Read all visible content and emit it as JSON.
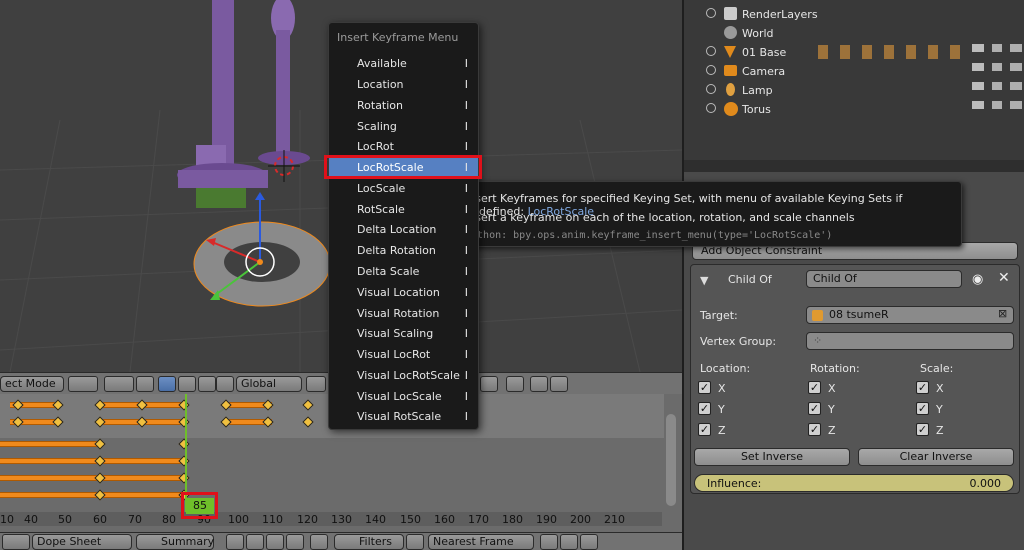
{
  "header3d": {
    "mode_label": "ect Mode",
    "orientation_label": "Global"
  },
  "dopesheet": {
    "current_frame": "85",
    "ruler_ticks": [
      "10",
      "40",
      "50",
      "60",
      "70",
      "80",
      "90",
      "100",
      "110",
      "120",
      "130",
      "140",
      "150",
      "160",
      "170",
      "180",
      "190",
      "200",
      "210"
    ]
  },
  "footer": {
    "editor_label": "Dope Sheet",
    "mode_label": "Summary",
    "filters_label": "Filters",
    "snap_label": "Nearest Frame"
  },
  "outliner": {
    "items": [
      {
        "label": "RenderLayers"
      },
      {
        "label": "World"
      },
      {
        "label": "01 Base"
      },
      {
        "label": "Camera"
      },
      {
        "label": "Lamp"
      },
      {
        "label": "Torus"
      }
    ]
  },
  "menu": {
    "title": "Insert Keyframe Menu",
    "items": [
      {
        "label": "Available",
        "shortcut": "I"
      },
      {
        "label": "Location",
        "shortcut": "I"
      },
      {
        "label": "Rotation",
        "shortcut": "I"
      },
      {
        "label": "Scaling",
        "shortcut": "I"
      },
      {
        "label": "LocRot",
        "shortcut": "I"
      },
      {
        "label": "LocRotScale",
        "shortcut": "I"
      },
      {
        "label": "LocScale",
        "shortcut": "I"
      },
      {
        "label": "RotScale",
        "shortcut": "I"
      },
      {
        "label": "Delta Location",
        "shortcut": "I"
      },
      {
        "label": "Delta Rotation",
        "shortcut": "I"
      },
      {
        "label": "Delta Scale",
        "shortcut": "I"
      },
      {
        "label": "Visual Location",
        "shortcut": "I"
      },
      {
        "label": "Visual Rotation",
        "shortcut": "I"
      },
      {
        "label": "Visual Scaling",
        "shortcut": "I"
      },
      {
        "label": "Visual LocRot",
        "shortcut": "I"
      },
      {
        "label": "Visual LocRotScale",
        "shortcut": "I"
      },
      {
        "label": "Visual LocScale",
        "shortcut": "I"
      },
      {
        "label": "Visual RotScale",
        "shortcut": "I"
      }
    ]
  },
  "tooltip": {
    "line1": "Insert Keyframes for specified Keying Set, with menu of available Keying Sets if undefined:",
    "line1_value": "LocRotScale",
    "line2": "Insert a keyframe on each of the location, rotation, and scale channels",
    "python": "Python: bpy.ops.anim.keyframe_insert_menu(type='LocRotScale')"
  },
  "constraints": {
    "add_label": "Add Object Constraint",
    "panel_title": "Child Of",
    "name_value": "Child Of",
    "target_label": "Target:",
    "target_value": "08 tsumeR",
    "vertex_group_label": "Vertex Group:",
    "location_label": "Location:",
    "rotation_label": "Rotation:",
    "scale_label": "Scale:",
    "axis_x": "X",
    "axis_y": "Y",
    "axis_z": "Z",
    "set_inverse_label": "Set Inverse",
    "clear_inverse_label": "Clear Inverse",
    "influence_label": "Influence:",
    "influence_value": "0.000"
  },
  "colors": {
    "accent": "#5680c2",
    "highlight_box": "#e0101a",
    "keyframe_bar": "#f08a1c",
    "current_frame_marker": "#6fbf2a"
  }
}
